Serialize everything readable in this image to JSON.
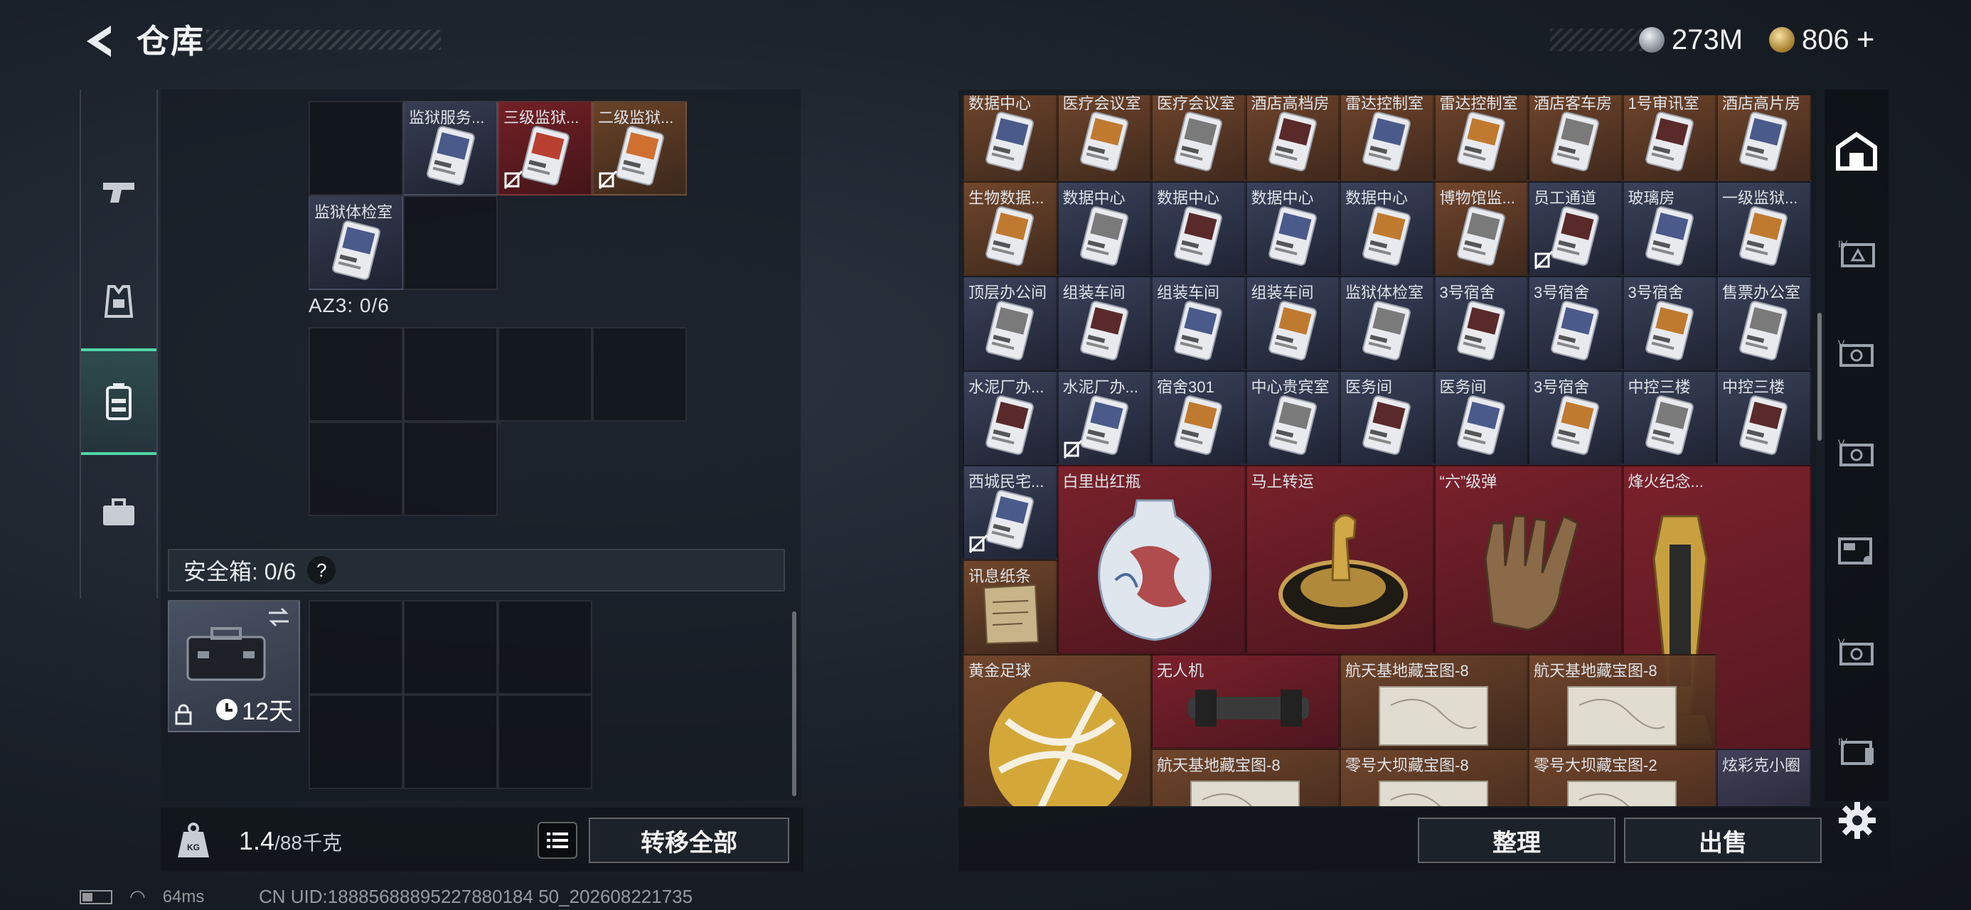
{
  "header": {
    "title": "仓库"
  },
  "currency": {
    "silver": "273M",
    "gold": "806",
    "gold_plus": "+"
  },
  "left": {
    "top_items": [
      {
        "label": "",
        "style": "empty"
      },
      {
        "label": "监狱服务...",
        "style": "item-blue",
        "nocarry": false
      },
      {
        "label": "三级监狱...",
        "style": "item-red",
        "nocarry": true
      },
      {
        "label": "二级监狱...",
        "style": "item-brown",
        "nocarry": true
      }
    ],
    "second_row": [
      {
        "label": "监狱体检室",
        "style": "item-blue"
      }
    ],
    "az3_label": "AZ3: 0/6",
    "safebox_label": "安全箱: 0/6",
    "safebox_help": "?",
    "safebox_days": "12天",
    "weight_value": "1.4",
    "weight_unit": "/88千克",
    "transfer_all": "转移全部"
  },
  "right": {
    "rows": [
      [
        "数据中心",
        "医疗会议室",
        "医疗会议室",
        "酒店高档房",
        "雷达控制室",
        "雷达控制室",
        "酒店客车房",
        "1号审讯室",
        "酒店高片房"
      ],
      [
        "生物数据...",
        "数据中心",
        "数据中心",
        "数据中心",
        "数据中心",
        "博物馆监...",
        "员工通道",
        "玻璃房",
        "一级监狱..."
      ],
      [
        "顶层办公间",
        "组装车间",
        "组装车间",
        "组装车间",
        "监狱体检室",
        "3号宿舍",
        "3号宿舍",
        "3号宿舍",
        "售票办公室"
      ],
      [
        "水泥厂办...",
        "水泥厂办...",
        "宿舍301",
        "中心贵宾室",
        "医务间",
        "医务间",
        "3号宿舍",
        "中控三楼",
        "中控三楼"
      ]
    ],
    "big_items": {
      "xicheng": "西城民宅...",
      "xunxi": "讯息纸条",
      "vase": "白里出红瓶",
      "mashang": "马上转运",
      "liu": "“六”级弹",
      "fenghuo": "烽火纪念...",
      "football": "黄金足球",
      "drone": "无人机",
      "map1": "航天基地藏宝图-8",
      "map2": "航天基地藏宝图-8",
      "map3": "航天基地藏宝图-8",
      "map4": "零号大坝藏宝图-8",
      "map5": "零号大坝藏宝图-2",
      "xuancai": "炫彩克小圈"
    },
    "sort": "整理",
    "sell": "出售"
  },
  "status": {
    "ping": "64ms",
    "uid": "CN UID:18885688895227880184 50_202608221735"
  },
  "colors": {
    "accent": "#4fd6a8",
    "red_item": "#7a2026",
    "blue_item": "#3c425a",
    "brown_item": "#6e4428"
  }
}
